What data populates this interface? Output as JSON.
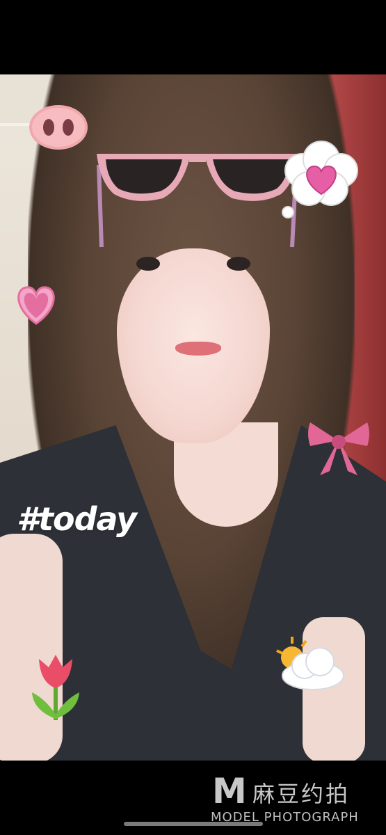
{
  "photo": {
    "caption": "#today"
  },
  "stickers": {
    "pig_nose": "pig-nose-sticker",
    "sunglasses": "pink-sunglasses-sticker",
    "cloud_heart": "thought-cloud-heart-sticker",
    "heart": "pink-heart-sticker",
    "bow": "pink-bow-sticker",
    "sun_cloud": "sun-behind-cloud-sticker",
    "tulip": "tulip-sticker"
  },
  "watermark": {
    "brand": "麻豆约拍",
    "letter": "M",
    "subtitle": "MODEL PHOTOGRAPH"
  },
  "colors": {
    "pink": "#e56ea0",
    "sticker_pink": "#e9a9b6",
    "dress": "#2d3036",
    "door": "#a84040"
  }
}
